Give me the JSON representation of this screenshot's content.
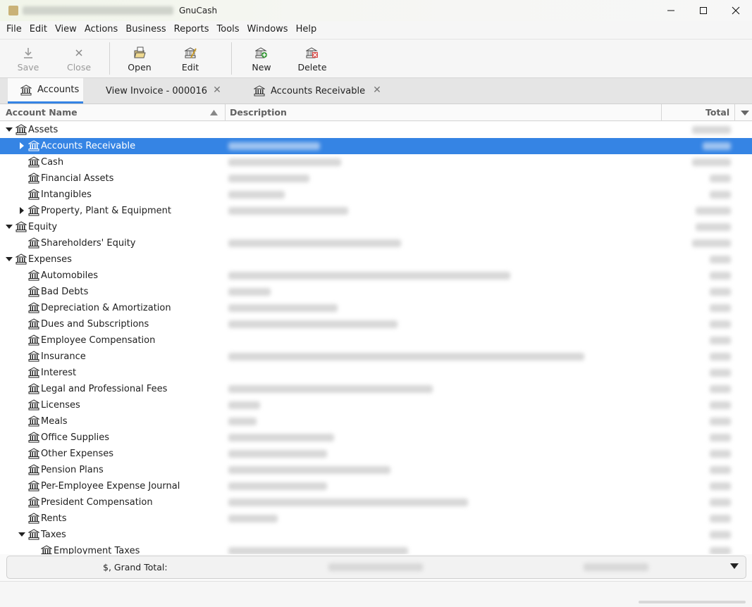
{
  "window": {
    "title": "GnuCash",
    "controls": [
      "—",
      "☐",
      "✕"
    ]
  },
  "menu": [
    "File",
    "Edit",
    "View",
    "Actions",
    "Business",
    "Reports",
    "Tools",
    "Windows",
    "Help"
  ],
  "toolbar": {
    "save": "Save",
    "close": "Close",
    "open": "Open",
    "edit": "Edit",
    "new": "New",
    "delete": "Delete"
  },
  "tabs": [
    {
      "label": "Accounts",
      "icon": "bank-icon"
    },
    {
      "label": "View Invoice - 000016",
      "icon": ""
    },
    {
      "label": "Accounts Receivable",
      "icon": "bank-icon"
    }
  ],
  "tab_close": "✕",
  "columns": {
    "name": "Account Name",
    "description": "Description",
    "total": "Total"
  },
  "accounts": [
    {
      "name": "Assets",
      "level": 0,
      "expander": "expanded"
    },
    {
      "name": "Accounts Receivable",
      "level": 1,
      "expander": "collapsed",
      "selected": true
    },
    {
      "name": "Cash",
      "level": 1,
      "expander": "none"
    },
    {
      "name": "Financial Assets",
      "level": 1,
      "expander": "none"
    },
    {
      "name": "Intangibles",
      "level": 1,
      "expander": "none"
    },
    {
      "name": "Property, Plant & Equipment",
      "level": 1,
      "expander": "collapsed"
    },
    {
      "name": "Equity",
      "level": 0,
      "expander": "expanded"
    },
    {
      "name": "Shareholders' Equity",
      "level": 1,
      "expander": "none"
    },
    {
      "name": "Expenses",
      "level": 0,
      "expander": "expanded"
    },
    {
      "name": "Automobiles",
      "level": 1,
      "expander": "none"
    },
    {
      "name": "Bad Debts",
      "level": 1,
      "expander": "none"
    },
    {
      "name": "Depreciation & Amortization",
      "level": 1,
      "expander": "none"
    },
    {
      "name": "Dues and Subscriptions",
      "level": 1,
      "expander": "none"
    },
    {
      "name": "Employee Compensation",
      "level": 1,
      "expander": "none"
    },
    {
      "name": "Insurance",
      "level": 1,
      "expander": "none"
    },
    {
      "name": "Interest",
      "level": 1,
      "expander": "none"
    },
    {
      "name": "Legal and Professional Fees",
      "level": 1,
      "expander": "none"
    },
    {
      "name": "Licenses",
      "level": 1,
      "expander": "none"
    },
    {
      "name": "Meals",
      "level": 1,
      "expander": "none"
    },
    {
      "name": "Office Supplies",
      "level": 1,
      "expander": "none"
    },
    {
      "name": "Other Expenses",
      "level": 1,
      "expander": "none"
    },
    {
      "name": "Pension Plans",
      "level": 1,
      "expander": "none"
    },
    {
      "name": "Per-Employee Expense Journal",
      "level": 1,
      "expander": "none"
    },
    {
      "name": "President Compensation",
      "level": 1,
      "expander": "none"
    },
    {
      "name": "Rents",
      "level": 1,
      "expander": "none"
    },
    {
      "name": "Taxes",
      "level": 1,
      "expander": "expanded"
    },
    {
      "name": "Employment Taxes",
      "level": 2,
      "expander": "none"
    }
  ],
  "summary": {
    "label": "$, Grand Total:"
  },
  "colors": {
    "accent": "#3584e4",
    "selected_text": "#ffffff"
  }
}
